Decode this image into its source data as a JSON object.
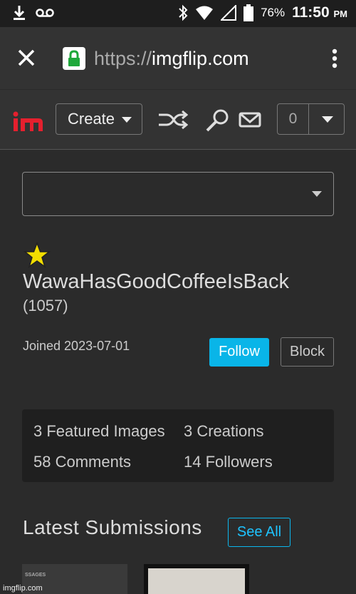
{
  "status_bar": {
    "battery_percent": "76%",
    "time": "11:50",
    "ampm": "PM"
  },
  "browser": {
    "url_scheme": "https://",
    "url_host": "imgflip.com"
  },
  "nav": {
    "create_label": "Create",
    "notification_count": "0"
  },
  "profile": {
    "username": "WawaHasGoodCoffeeIsBack",
    "points": "(1057)",
    "joined": "Joined 2023-07-01",
    "follow_label": "Follow",
    "block_label": "Block"
  },
  "stats": {
    "featured_images": "3 Featured Images",
    "creations": "3 Creations",
    "comments": "58 Comments",
    "followers": "14 Followers"
  },
  "latest": {
    "title": "Latest Submissions",
    "see_all_label": "See All",
    "thumb1_text": "SSAGES"
  },
  "watermark": "imgflip.com",
  "colors": {
    "accent": "#09b5e8",
    "logo_red": "#e5202e",
    "star": "#f2dd00"
  }
}
